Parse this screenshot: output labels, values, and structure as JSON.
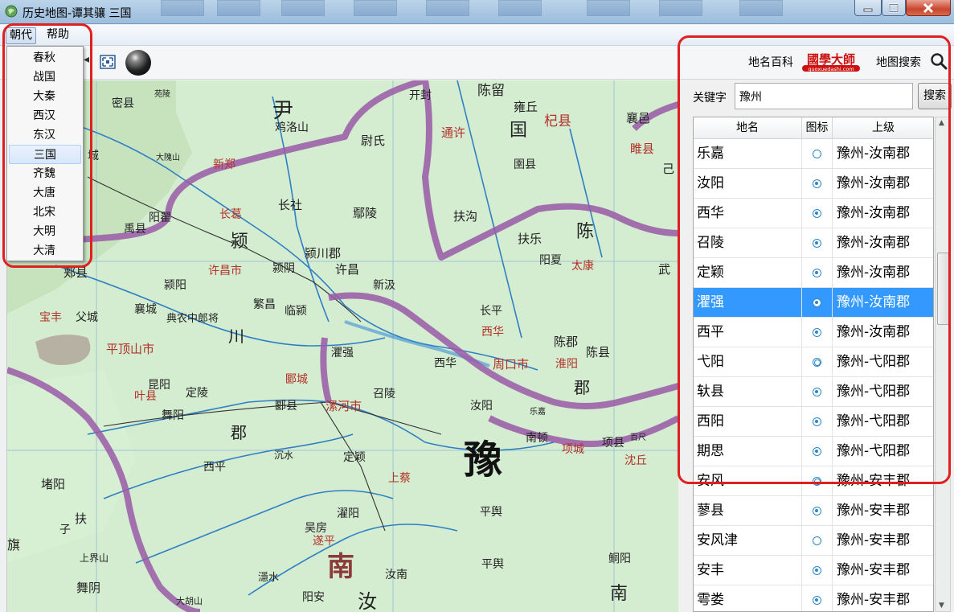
{
  "window": {
    "title": "历史地图-谭其骧  三国"
  },
  "menubar": {
    "items": [
      "朝代",
      "帮助"
    ]
  },
  "dynasty_menu": {
    "items": [
      "春秋",
      "战国",
      "大秦",
      "西汉",
      "东汉",
      "三国",
      "齐魏",
      "大唐",
      "北宋",
      "大明",
      "大清"
    ],
    "highlighted": "三国"
  },
  "toolbar": {
    "fit_icon": "fit-to-window-icon",
    "globe_icon": "globe-icon"
  },
  "header_links": {
    "baike": "地名百科",
    "logo_text": "國學大師",
    "logo_sub": "guoxuedashi.com",
    "map_search": "地图搜索",
    "search_icon": "search-icon"
  },
  "search": {
    "label": "关键字",
    "value": "豫州",
    "button": "搜索"
  },
  "table": {
    "columns": [
      "地名",
      "图标",
      "上级"
    ],
    "rows": [
      {
        "name": "乐嘉",
        "icon": "hollow",
        "parent": "豫州-汝南郡"
      },
      {
        "name": "汝阳",
        "icon": "filled",
        "parent": "豫州-汝南郡"
      },
      {
        "name": "西华",
        "icon": "filled",
        "parent": "豫州-汝南郡"
      },
      {
        "name": "召陵",
        "icon": "filled",
        "parent": "豫州-汝南郡"
      },
      {
        "name": "定颖",
        "icon": "filled",
        "parent": "豫州-汝南郡"
      },
      {
        "name": "灈强",
        "icon": "filled",
        "parent": "豫州-汝南郡",
        "selected": true
      },
      {
        "name": "西平",
        "icon": "filled",
        "parent": "豫州-汝南郡"
      },
      {
        "name": "弋阳",
        "icon": "double",
        "parent": "豫州-弋阳郡"
      },
      {
        "name": "轪县",
        "icon": "filled",
        "parent": "豫州-弋阳郡"
      },
      {
        "name": "西阳",
        "icon": "filled",
        "parent": "豫州-弋阳郡"
      },
      {
        "name": "期思",
        "icon": "filled",
        "parent": "豫州-弋阳郡"
      },
      {
        "name": "安风",
        "icon": "double",
        "parent": "豫州-安丰郡"
      },
      {
        "name": "蓼县",
        "icon": "filled",
        "parent": "豫州-安丰郡"
      },
      {
        "name": "安风津",
        "icon": "hollow",
        "parent": "豫州-安丰郡"
      },
      {
        "name": "安丰",
        "icon": "filled",
        "parent": "豫州-安丰郡"
      },
      {
        "name": "雩娄",
        "icon": "filled",
        "parent": "豫州-安丰郡"
      }
    ]
  },
  "map": {
    "labels": [
      "尹",
      "开封",
      "陈留",
      "雍丘",
      "国",
      "杞县",
      "襄邑",
      "睢县",
      "己",
      "密县",
      "苑陵",
      "尉氏",
      "通许",
      "圉县",
      "鸡洛山",
      "大隗山",
      "新郑",
      "城",
      "长社",
      "鄢陵",
      "扶沟",
      "长葛",
      "禹县",
      "阳翟",
      "颍",
      "扶乐",
      "陈",
      "阳夏",
      "太康",
      "颍川郡",
      "许昌",
      "许昌市",
      "颍阴",
      "郏县",
      "新汲",
      "武",
      "颍阳",
      "宝丰",
      "父城",
      "襄城",
      "典农中郎将",
      "繁昌",
      "临颍",
      "长平",
      "川",
      "西华",
      "平顶山市",
      "陈郡",
      "陈县",
      "灈强",
      "周口市",
      "淮阳",
      "昆阳",
      "叶县",
      "郾城",
      "西华",
      "郡",
      "定陵",
      "郾县",
      "召陵",
      "漯河市",
      "汝阳",
      "乐嘉",
      "舞阳",
      "郡",
      "南顿",
      "项城",
      "项县",
      "百尺",
      "沈丘",
      "豫",
      "西平",
      "沉水",
      "定颖",
      "堵阳",
      "上蔡",
      "平舆",
      "扶",
      "子",
      "旗",
      "上界山",
      "濯阳",
      "吴房",
      "遂平",
      "南",
      "平舆",
      "鲖阳",
      "舞阴",
      "濦水",
      "汝南",
      "汝",
      "南",
      "阳安",
      "大胡山"
    ]
  }
}
